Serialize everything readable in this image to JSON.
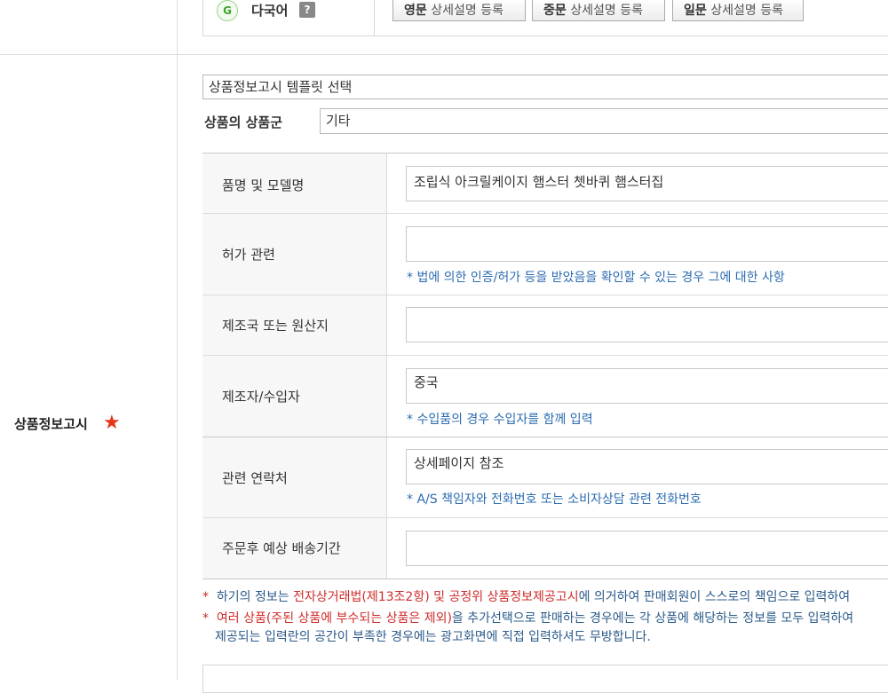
{
  "multilingual": {
    "badge": "G",
    "label": "다국어",
    "help": "?",
    "buttons": [
      {
        "lang": "영문",
        "text": "상세설명 등록"
      },
      {
        "lang": "중문",
        "text": "상세설명 등록"
      },
      {
        "lang": "일문",
        "text": "상세설명 등록"
      }
    ]
  },
  "section": {
    "label": "상품정보고시",
    "required_icon": "★"
  },
  "template_select": {
    "value": "상품정보고시 템플릿 선택"
  },
  "product_group": {
    "label": "상품의 상품군",
    "value": "기타"
  },
  "fields": [
    {
      "label": "품명 및 모델명",
      "value": "조립식 아크릴케이지 햄스터 쳇바퀴 햄스터집",
      "hint": ""
    },
    {
      "label": "허가 관련",
      "value": "",
      "hint": "* 법에 의한 인증/허가 등을 받았음을 확인할 수 있는 경우 그에 대한 사항"
    },
    {
      "label": "제조국 또는 원산지",
      "value": "",
      "hint": ""
    },
    {
      "label": "제조자/수입자",
      "value": "중국",
      "hint": "* 수입품의 경우 수입자를 함께 입력"
    },
    {
      "label": "관련 연락처",
      "value": "상세페이지 참조",
      "hint": "* A/S 책임자와 전화번호 또는 소비자상담 관련 전화번호"
    },
    {
      "label": "주문후 예상 배송기간",
      "value": "",
      "hint": ""
    }
  ],
  "notices": {
    "n1": {
      "mark": "*",
      "pre": "하기의 정보는 ",
      "red": "전자상거래법(제13조2항) 및 공정위 상품정보제공고시",
      "post": "에 의거하여 판매회원이 스스로의 책임으로 입력하여"
    },
    "n2": {
      "mark": "*",
      "red": "여러 상품(주된 상품에 부수되는 상품은 제외)",
      "post": "을 추가선택으로 판매하는 경우에는 각 상품에 해당하는 정보를 모두 입력하여"
    },
    "n3": {
      "text": "제공되는 입력란의 공간이 부족한 경우에는 광고화면에 직접 입력하셔도 무방합니다."
    }
  },
  "colors": {
    "accent_red": "#d02b2b",
    "hint_blue": "#2b6cb0",
    "star": "#e5361a",
    "g_badge": "#39a52a"
  }
}
